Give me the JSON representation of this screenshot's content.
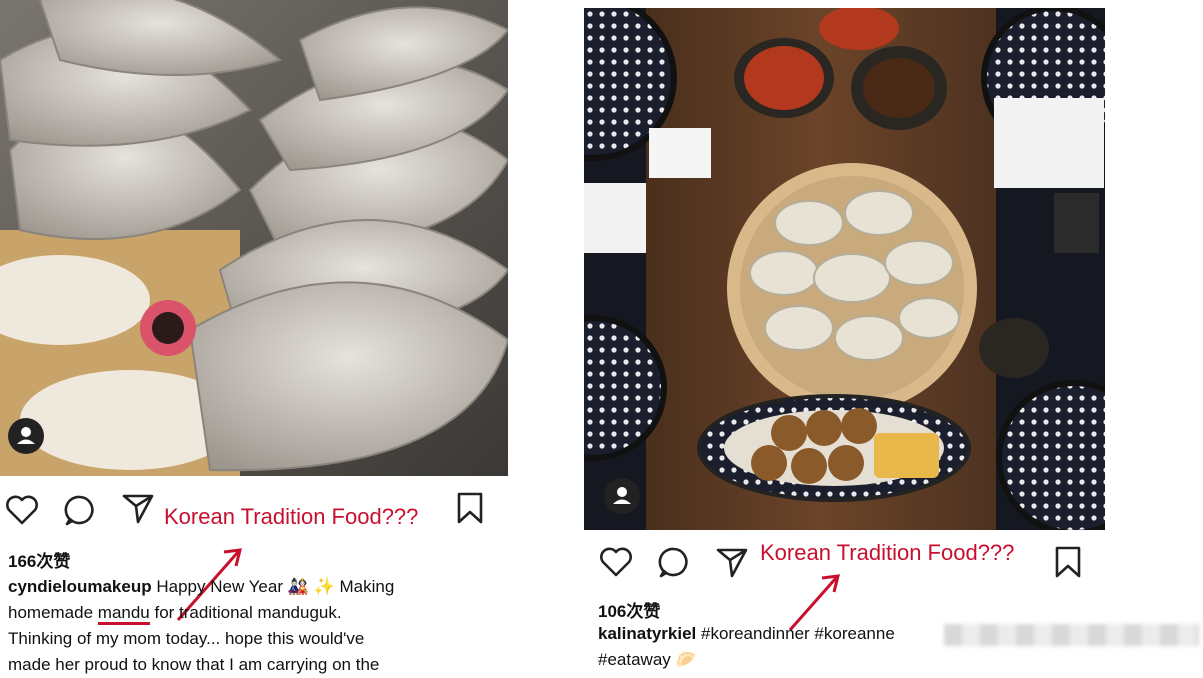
{
  "left_post": {
    "likes": "166次赞",
    "username": "cyndieloumakeup",
    "caption_line1": "Happy New Year 🎎 ✨ Making",
    "caption_line2a": "homemade ",
    "caption_highlight": "mandu",
    "caption_line2b": " for traditional manduguk.",
    "caption_line3": "Thinking of my mom today... hope this would've",
    "caption_line4": "made her proud to know that I am carrying on the",
    "annotation": "Korean Tradition Food???"
  },
  "right_post": {
    "likes": "106次赞",
    "username": "kalinatyrkiel",
    "caption_tags": "#koreandinner #koreanne",
    "caption_line2": "#eataway 🥟",
    "annotation": "Korean Tradition Food???"
  },
  "colors": {
    "annotation_red": "#c8102e",
    "icon_dark": "#222222"
  },
  "icons": [
    "heart-icon",
    "comment-icon",
    "share-icon",
    "bookmark-icon",
    "user-icon"
  ]
}
